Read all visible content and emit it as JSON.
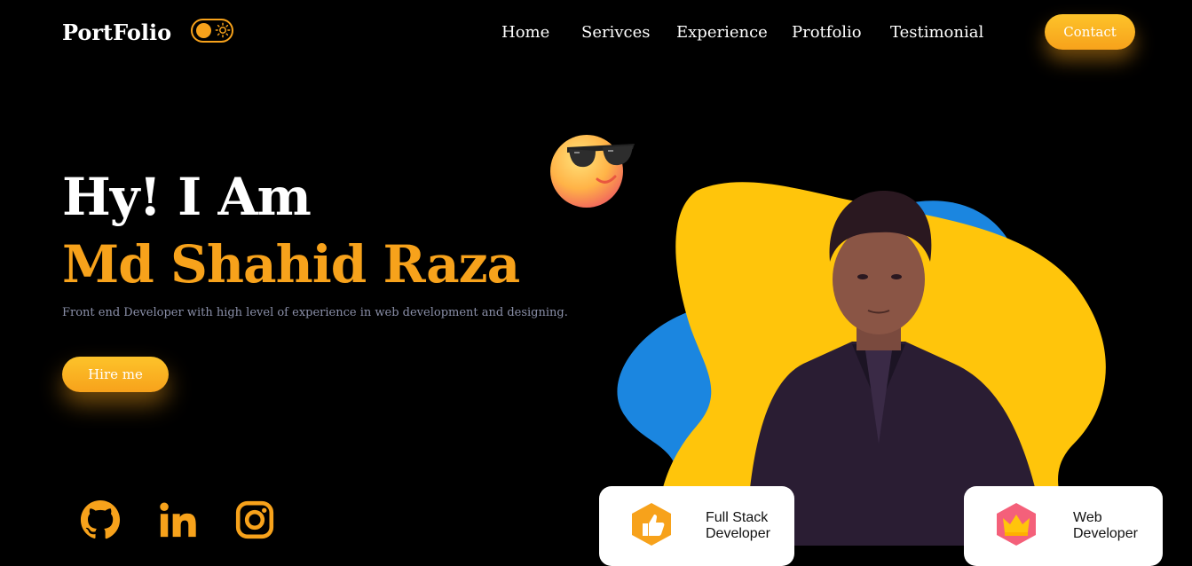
{
  "brand": "PortFolio",
  "nav": {
    "items": [
      "Home",
      "Serivces",
      "Experience",
      "Protfolio",
      "Testimonial"
    ],
    "contact_label": "Contact"
  },
  "hero": {
    "greeting": "Hy! I Am",
    "name": "Md Shahid Raza",
    "description": "Front end Developer with high level of experience in web development and designing.",
    "hire_label": "Hire me"
  },
  "social": [
    "github-icon",
    "linkedin-icon",
    "instagram-icon"
  ],
  "cards": [
    {
      "line1": "Full Stack",
      "line2": "Developer",
      "icon": "thumbs-up-icon"
    },
    {
      "line1": "Web",
      "line2": "Developer",
      "icon": "crown-icon"
    }
  ],
  "colors": {
    "accent": "#f7a21b",
    "blob_yellow": "#ffc50b",
    "blob_blue": "#1b86e0",
    "background": "#000000"
  }
}
